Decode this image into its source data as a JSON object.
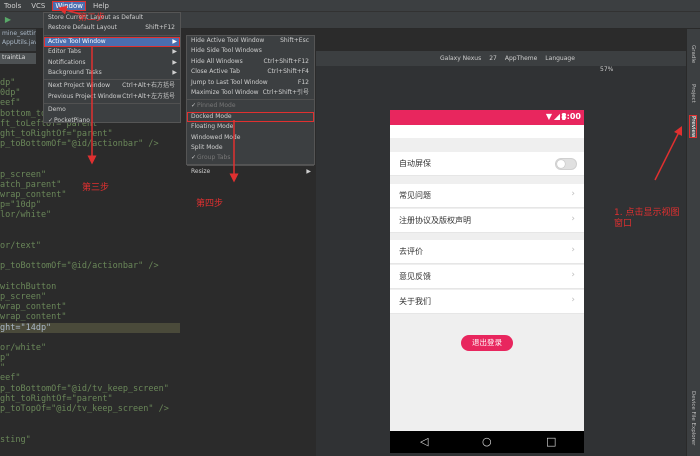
{
  "menubar": {
    "items": [
      "Tools",
      "VCS",
      "Window",
      "Help"
    ]
  },
  "editor": {
    "tabs": [
      "mine_setting",
      "AppUtils.java",
      "traintLa"
    ],
    "code_lines": [
      "dp\"",
      "0dp\"",
      "eef\"",
      "bottom_to",
      "ft_toLeftOf=\"parent\"",
      "ght_toRightOf=\"parent\"",
      "p_toBottomOf=\"@id/actionbar\" />",
      "",
      "",
      "p_screen\"",
      "atch_parent\"",
      "wrap_content\"",
      "p=\"10dp\"",
      "lor/white\"",
      "",
      "",
      "or/text\"",
      "",
      "p_toBottomOf=\"@id/actionbar\" />",
      "",
      "witchButton",
      "p_screen\"",
      "wrap_content\"",
      "wrap_content\"",
      "ght=\"14dp\"",
      "",
      "or/white\"",
      "p\"",
      "\"",
      "eef\"",
      "p_toBottomOf=\"@id/tv_keep_screen\"",
      "ght_toRightOf=\"parent\"",
      "p_toTopOf=\"@id/tv_keep_screen\" />",
      "",
      "",
      "sting\""
    ]
  },
  "window_menu": {
    "items": [
      {
        "label": "Store Current Layout as Default",
        "shortcut": ""
      },
      {
        "label": "Restore Default Layout",
        "shortcut": "Shift+F12"
      },
      {
        "label": "Active Tool Window",
        "shortcut": "",
        "submenu": true
      },
      {
        "label": "Editor Tabs",
        "shortcut": "",
        "submenu": true
      },
      {
        "label": "Notifications",
        "shortcut": "",
        "submenu": true
      },
      {
        "label": "Background Tasks",
        "shortcut": "",
        "submenu": true
      },
      {
        "label": "Next Project Window",
        "shortcut": "Ctrl+Alt+右方括号"
      },
      {
        "label": "Previous Project Window",
        "shortcut": "Ctrl+Alt+左方括号"
      },
      {
        "label": "Demo",
        "shortcut": ""
      },
      {
        "label": "PocketPiano",
        "shortcut": ""
      }
    ]
  },
  "tool_window_menu": {
    "items": [
      {
        "label": "Hide Active Tool Window",
        "shortcut": "Shift+Esc"
      },
      {
        "label": "Hide Side Tool Windows",
        "shortcut": ""
      },
      {
        "label": "Hide All Windows",
        "shortcut": "Ctrl+Shift+F12"
      },
      {
        "label": "Close Active Tab",
        "shortcut": "Ctrl+Shift+F4"
      },
      {
        "label": "Jump to Last Tool Window",
        "shortcut": "F12"
      },
      {
        "label": "Maximize Tool Window",
        "shortcut": "Ctrl+Shift+引号"
      },
      {
        "label": "Pinned Mode",
        "shortcut": ""
      },
      {
        "label": "Docked Mode",
        "shortcut": ""
      },
      {
        "label": "Floating Mode",
        "shortcut": ""
      },
      {
        "label": "Windowed Mode",
        "shortcut": ""
      },
      {
        "label": "Split Mode",
        "shortcut": ""
      },
      {
        "label": "Group Tabs",
        "shortcut": ""
      },
      {
        "label": "Resize",
        "shortcut": ""
      }
    ]
  },
  "preview_toolbar": {
    "device": "Galaxy Nexus",
    "api": "27",
    "theme": "AppTheme",
    "language": "Language",
    "zoom": "57%"
  },
  "phone": {
    "time": "8:00",
    "rows": [
      {
        "label": "自动屏保",
        "type": "switch"
      },
      {
        "label": "常见问题",
        "type": "chevron"
      },
      {
        "label": "注册协议及版权声明",
        "type": "chevron"
      },
      {
        "label": "去评价",
        "type": "chevron"
      },
      {
        "label": "意见反馈",
        "type": "chevron"
      },
      {
        "label": "关于我们",
        "type": "chevron"
      }
    ],
    "logout_label": "退出登录"
  },
  "right_strip": {
    "tabs": [
      "Gradle",
      "Project",
      "Preview",
      "Device File Explorer"
    ]
  },
  "annotations": {
    "step1": "1. 点击显示视图窗口",
    "step2": "第二步",
    "step3": "第三步",
    "step4": "第四步"
  },
  "colors": {
    "accent": "#e8265e",
    "annotation": "#e03030",
    "menu_selection": "#4b6eaf"
  }
}
